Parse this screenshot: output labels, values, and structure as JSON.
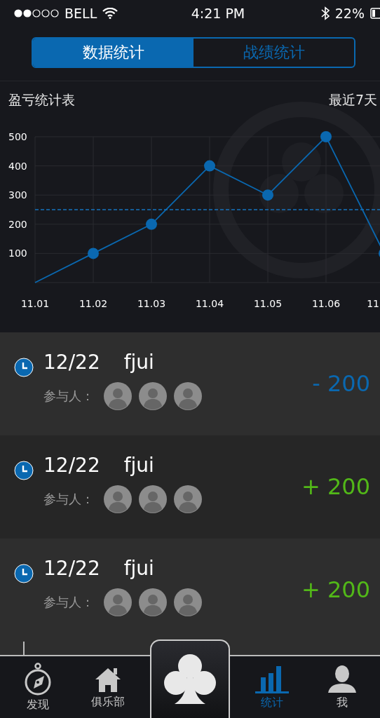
{
  "status_bar": {
    "carrier": "BELL",
    "time": "4:21 PM",
    "battery": "22%"
  },
  "tabs": [
    {
      "label": "数据统计",
      "selected": true
    },
    {
      "label": "战绩统计",
      "selected": false
    }
  ],
  "chart_panel": {
    "title": "盈亏统计表",
    "range": "最近7天",
    "chart_data": {
      "type": "line",
      "categories": [
        "11.01",
        "11.02",
        "11.03",
        "11.04",
        "11.05",
        "11.06",
        "11"
      ],
      "series": [
        {
          "color": "#0a68b0",
          "marker": "circle",
          "values": [
            0,
            100,
            200,
            400,
            300,
            500,
            100
          ]
        },
        {
          "color": "#1673bd",
          "line_style": "dashed",
          "values": [
            250,
            250,
            250,
            250,
            250,
            250,
            250
          ]
        }
      ],
      "ylim": [
        0,
        500
      ],
      "yticks": [
        100,
        200,
        300,
        400,
        500
      ],
      "grid": true
    }
  },
  "records": [
    {
      "date": "12/22",
      "name": "fjui",
      "participants_label": "参与人：",
      "amount": "- 200",
      "kind": "loss",
      "participants": [
        {
          "kind": "avatar"
        },
        {
          "kind": "avatar"
        },
        {
          "kind": "avatar"
        }
      ]
    },
    {
      "date": "12/22",
      "name": "fjui",
      "participants_label": "参与人：",
      "amount": "+ 200",
      "kind": "gain",
      "participants": [
        {
          "kind": "avatar"
        },
        {
          "kind": "avatar"
        },
        {
          "kind": "avatar"
        }
      ]
    },
    {
      "date": "12/22",
      "name": "fjui",
      "participants_label": "参与人：",
      "amount": "+ 200",
      "kind": "gain",
      "participants": [
        {
          "kind": "avatar"
        },
        {
          "kind": "avatar"
        },
        {
          "kind": "avatar"
        }
      ]
    }
  ],
  "nav": [
    {
      "kind": "compass",
      "label": "发现",
      "selected": false
    },
    {
      "kind": "home",
      "label": "俱乐部",
      "selected": false
    },
    {
      "kind": "club",
      "selected": false
    },
    {
      "kind": "stats",
      "label": "统计",
      "selected": true
    },
    {
      "kind": "user",
      "label": "我",
      "selected": false
    }
  ]
}
